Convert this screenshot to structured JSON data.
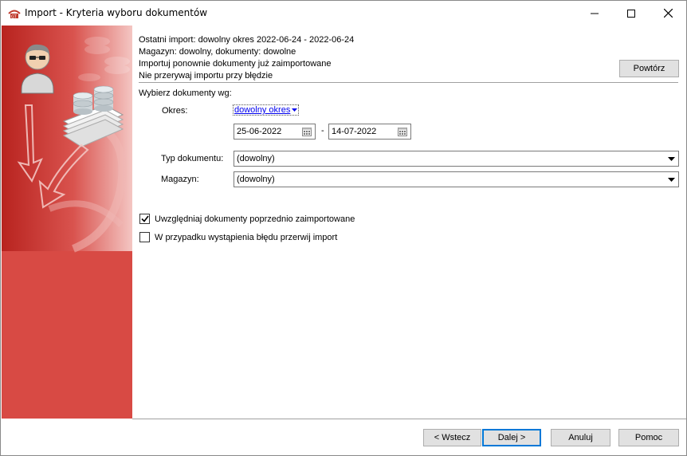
{
  "window": {
    "title": "Import - Kryteria wyboru dokumentów"
  },
  "info": {
    "last_import": "Ostatni import: dowolny okres 2022-06-24 - 2022-06-24",
    "warehouse": "Magazyn: dowolny, dokumenty: dowolne",
    "reimport": "Importuj ponownie dokumenty już zaimportowane",
    "no_interrupt": "Nie przerywaj importu przy błędzie",
    "repeat_button": "Powtórz"
  },
  "criteria": {
    "heading": "Wybierz dokumenty wg:",
    "period_label": "Okres:",
    "period_value": "dowolny okres",
    "date_from": "25-06-2022",
    "date_separator": "-",
    "date_to": "14-07-2022",
    "doc_type_label": "Typ dokumentu:",
    "doc_type_value": "(dowolny)",
    "warehouse_label": "Magazyn:",
    "warehouse_value": "(dowolny)"
  },
  "options": {
    "include_imported_label": "Uwzględniaj dokumenty poprzednio zaimportowane",
    "include_imported_checked": true,
    "stop_on_error_label": "W przypadku wystąpienia błędu przerwij import",
    "stop_on_error_checked": false
  },
  "footer": {
    "back_label": "< Wstecz",
    "next_label": "Dalej >",
    "cancel_label": "Anuluj",
    "help_label": "Pomoc"
  },
  "colors": {
    "banner": "#d84a44",
    "link": "#0000ee",
    "accent_border": "#0078d7"
  }
}
